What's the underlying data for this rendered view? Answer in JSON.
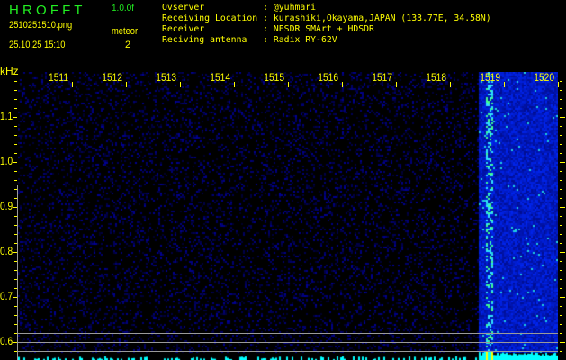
{
  "header": {
    "app_title": "H R O F F T",
    "version": "1.0.0f",
    "filename": "2510251510.png",
    "datetime": "25.10.25 15:10",
    "meteor_label": "meteor",
    "meteor_count": "2"
  },
  "info": [
    {
      "label": "Ovserver          ",
      "value": ": @yuhmari"
    },
    {
      "label": "Receiving Location",
      "value": ": kurashiki,Okayama,JAPAN (133.77E, 34.58N)"
    },
    {
      "label": "Receiver          ",
      "value": ": NESDR SMArt + HDSDR"
    },
    {
      "label": "Reciving antenna  ",
      "value": ": Radix RY-62V"
    }
  ],
  "axes": {
    "y_unit": "kHz",
    "x_ticks": [
      "1511",
      "1512",
      "1513",
      "1514",
      "1515",
      "1516",
      "1517",
      "1518",
      "1519",
      "1520"
    ],
    "y_ticks": [
      "1.1",
      "1.0",
      "0.9",
      "0.8",
      "0.7",
      "0.6"
    ]
  },
  "colors": {
    "title": "#22ee22",
    "text": "#ffff00",
    "noise": "#1020c0",
    "meteor": "#00ffff"
  }
}
